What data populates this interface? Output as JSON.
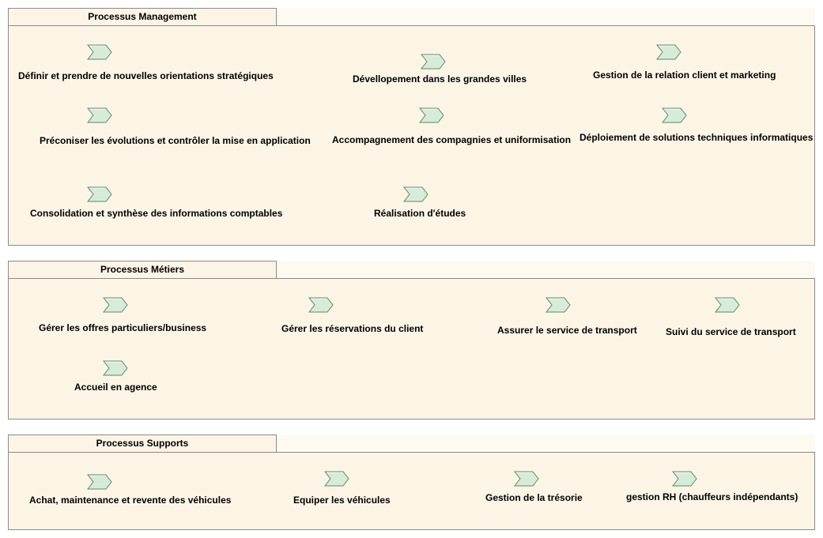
{
  "packages": [
    {
      "title": "Processus Management",
      "processes": [
        {
          "label": "Définir et prendre de nouvelles orientations stratégiques"
        },
        {
          "label": "Dévellopement dans les grandes villes"
        },
        {
          "label": "Gestion de la relation client et marketing"
        },
        {
          "label": "Préconiser les évolutions et contrôler la mise en application"
        },
        {
          "label": "Accompagnement des compagnies et uniformisation"
        },
        {
          "label": "Déploiement de solutions techniques informatiques"
        },
        {
          "label": "Consolidation et synthèse des informations comptables"
        },
        {
          "label": "Réalisation d'études"
        }
      ]
    },
    {
      "title": "Processus Métiers",
      "processes": [
        {
          "label": "Gérer les offres particuliers/business"
        },
        {
          "label": "Gérer les réservations du client"
        },
        {
          "label": "Assurer le service de transport"
        },
        {
          "label": "Suivi du service de transport"
        },
        {
          "label": "Accueil en agence"
        }
      ]
    },
    {
      "title": "Processus Supports",
      "processes": [
        {
          "label": "Achat, maintenance et revente des véhicules"
        },
        {
          "label": "Equiper les véhicules"
        },
        {
          "label": "Gestion de la trésorie"
        },
        {
          "label": "gestion RH (chauffeurs indépendants)"
        }
      ]
    }
  ],
  "icon": "bpmn-process-chevron-icon",
  "colors": {
    "package_fill": "#fcf5e6",
    "package_border": "#8a8a8a",
    "chevron_fill": "#d6ecd9",
    "chevron_stroke": "#5a8a66"
  }
}
